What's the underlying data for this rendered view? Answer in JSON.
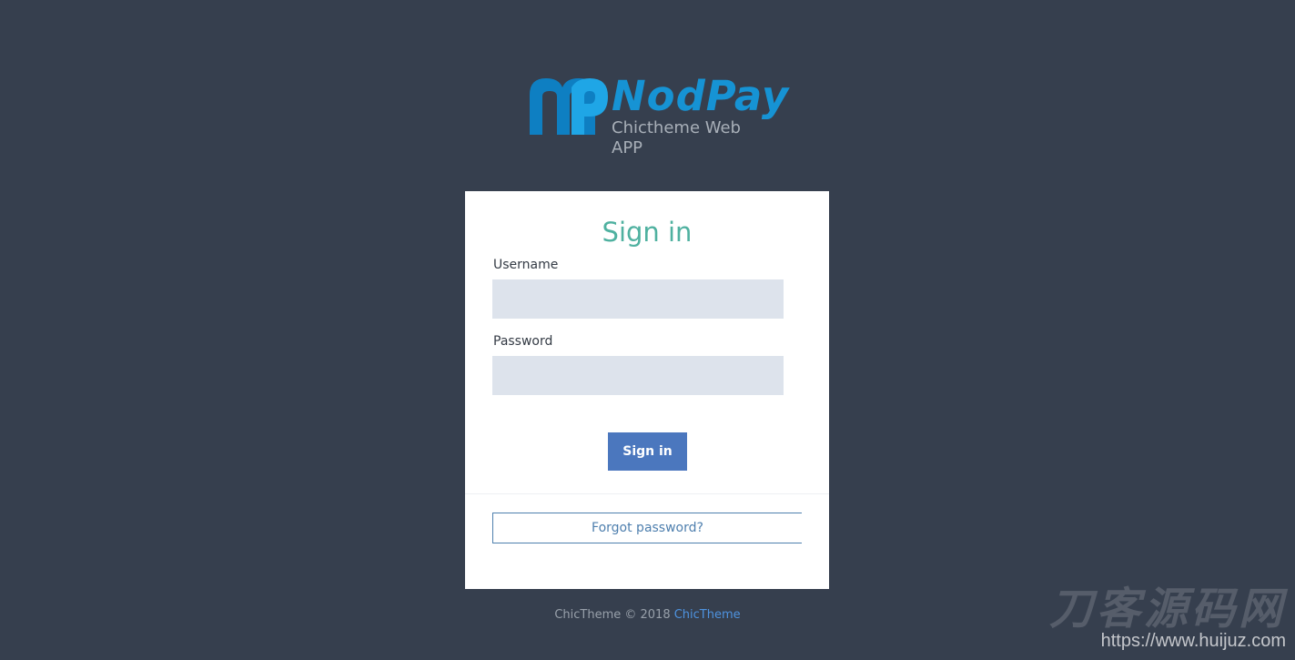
{
  "logo": {
    "brand": "NodPay",
    "tagline": "Chictheme Web APP",
    "mark_icon": "mp-logo-icon",
    "brand_color": "#1693d4"
  },
  "signin_card": {
    "title": "Sign in",
    "username_label": "Username",
    "username_value": "",
    "password_label": "Password",
    "password_value": "",
    "submit_label": "Sign in",
    "forgot_label": "Forgot password?"
  },
  "footer": {
    "text": "ChicTheme © 2018",
    "link": "ChicTheme"
  },
  "watermark": {
    "chinese": "刀客源码网",
    "url": "https://www.huijuz.com"
  },
  "colors": {
    "background": "#363f4e",
    "title": "#4fb1a0",
    "button": "#4b77be",
    "input_bg": "#dde3ec",
    "link": "#4e93e0"
  }
}
